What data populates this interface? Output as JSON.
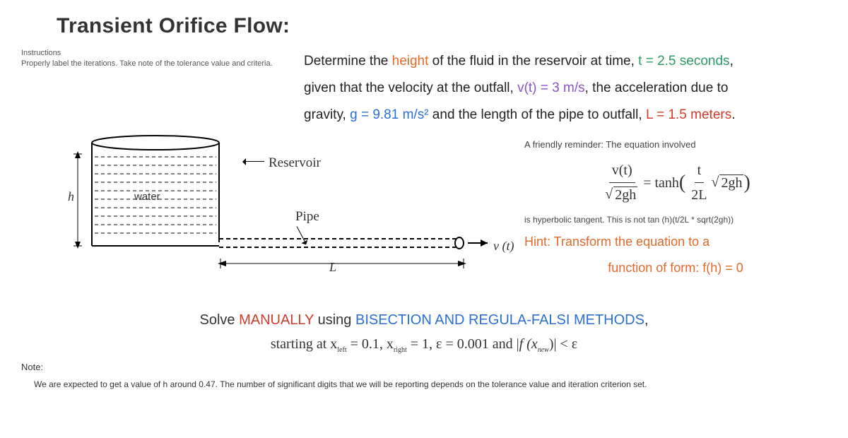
{
  "title": "Transient Orifice Flow:",
  "instructions": {
    "label": "Instructions",
    "body": "Properly label the iterations. Take note of the tolerance value and criteria."
  },
  "problem": {
    "line1_a": "Determine the ",
    "height_word": "height",
    "line1_b": " of the fluid in the reservoir at time, ",
    "t_expr": "t = 2.5 seconds",
    "line1_c": ",",
    "line2_a": "given that the velocity at the outfall, ",
    "v_expr": "v(t) = 3 m/s",
    "line2_b": ", the acceleration due to",
    "line3_a": "gravity, ",
    "g_expr": "g = 9.81 m/s²",
    "line3_b": " and the length of the pipe to outfall, ",
    "L_expr": "L = 1.5 meters",
    "line3_c": "."
  },
  "diagram": {
    "h": "h",
    "water": "water",
    "reservoir": "Reservoir",
    "pipe": "Pipe",
    "L": "L",
    "vt": "v (t)"
  },
  "side": {
    "reminder_label": "A friendly reminder: The equation involved",
    "eqn": {
      "num_left": "v(t)",
      "den_left": "2gh",
      "eq": " = tanh ",
      "num_right_t": "t",
      "den_right_2L": "2L",
      "rad_right": "2gh"
    },
    "hyptan_note": "is hyperbolic tangent. This is not tan (h)(t/2L * sqrt(2gh))",
    "hint_line1": "Hint: Transform the equation to a",
    "hint_line2": "function of form: f(h) = 0"
  },
  "solve": {
    "line1_a": "Solve ",
    "manually": "MANUALLY",
    "line1_b": " using ",
    "methods": "BISECTION AND REGULA-FALSI METHODS",
    "line1_c": ",",
    "line2_a": "starting at x",
    "left_sub": "left",
    "line2_b": " = 0.1, x",
    "right_sub": "right",
    "line2_c": " = 1, ε = 0.001  and |",
    "fxnew": "f (x",
    "new_sub": "new",
    "line2_d": ")|  <  ε"
  },
  "note": {
    "label": "Note:",
    "body": "We are expected to get a value of h around 0.47. The number of significant digits that we will be reporting depends on the tolerance value and iteration criterion set."
  }
}
